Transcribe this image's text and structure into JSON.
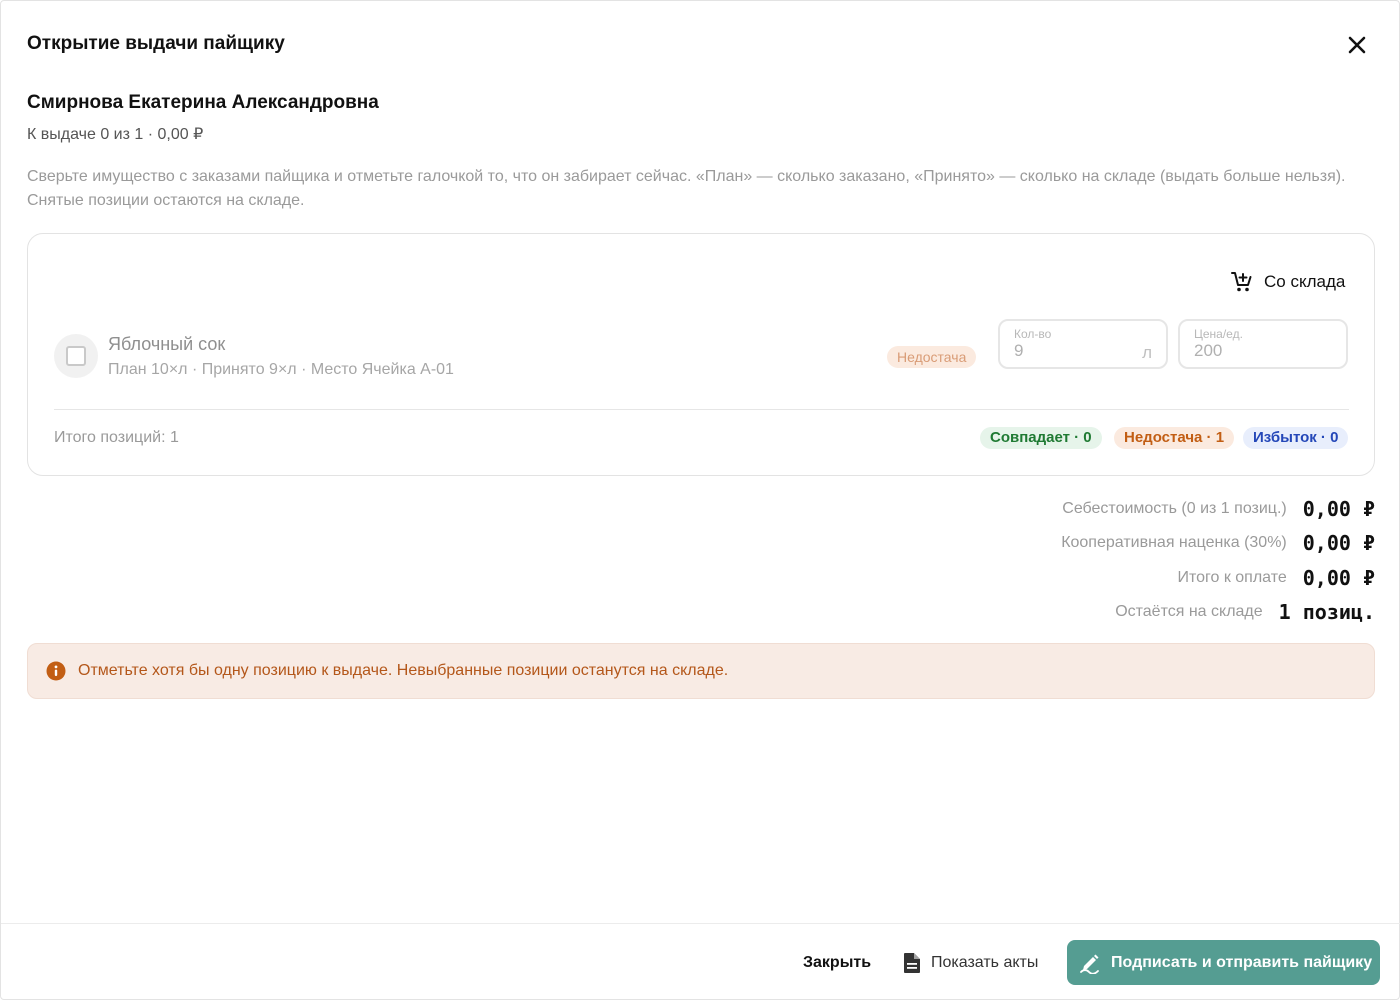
{
  "dialog": {
    "title": "Открытие выдачи пайщику",
    "close_icon": "close-icon"
  },
  "member": {
    "name": "Смирнова Екатерина Александровна",
    "summary": "К выдаче 0 из 1 · 0,00 ₽"
  },
  "hint": "Сверьте имущество с заказами пайщика и отметьте галочкой то, что он забирает сейчас. «План» — сколько заказано, «Принято» — сколько на складе (выдать больше нельзя). Снятые позиции остаются на складе.",
  "card": {
    "stock_button": {
      "label": "Со склада",
      "icon": "cart-add-icon"
    },
    "items": [
      {
        "name": "Яблочный сок",
        "meta": "План 10×л · Принято 9×л · Место Ячейка A-01",
        "checked": false,
        "status": "Недостача",
        "qty": {
          "label": "Кол-во",
          "value": "9",
          "unit": "л"
        },
        "price": {
          "label": "Цена/ед.",
          "value": "200"
        }
      }
    ],
    "total_positions": "Итого позиций: 1",
    "pills": {
      "match": "Совпадает · 0",
      "short": "Недостача · 1",
      "over": "Избыток · 0"
    }
  },
  "sums": {
    "cost": {
      "label": "Себестоимость (0 из 1 позиц.)",
      "value": "0,00 ₽"
    },
    "markup": {
      "label": "Кооперативная наценка (30%)",
      "value": "0,00 ₽"
    },
    "total": {
      "label": "Итого к оплате",
      "value": "0,00 ₽"
    },
    "remain": {
      "label": "Остаётся на складе",
      "value": "1 позиц."
    }
  },
  "alert": {
    "icon": "info-icon",
    "text": "Отметьте хотя бы одну позицию к выдаче. Невыбранные позиции останутся на складе."
  },
  "footer": {
    "close_label": "Закрыть",
    "acts_label": "Показать акты",
    "acts_icon": "document-icon",
    "sign_label": "Подписать и отправить пайщику",
    "sign_icon": "sign-icon"
  },
  "colors": {
    "accent": "#559d92",
    "shortage": "#c25e14",
    "match": "#1f7a33",
    "surplus": "#2447b8",
    "alert_bg": "#f8ebe4"
  }
}
